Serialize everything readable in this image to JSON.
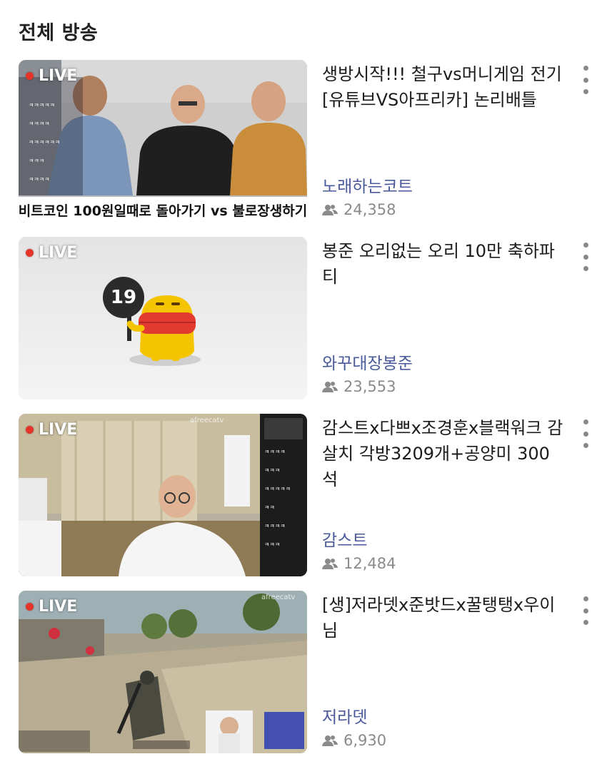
{
  "section": {
    "title": "전체 방송"
  },
  "live_label": "LIVE",
  "colors": {
    "live_dot": "#e5352a",
    "channel": "#4a5a9a",
    "viewers": "#8a8a8a"
  },
  "icons": {
    "viewers": "people-icon",
    "more": "more-vertical-icon"
  },
  "items": [
    {
      "title": "생방시작!!! 철구vs머니게임 전기 [유튜브VS아프리카] 논리배틀",
      "channel": "노래하는코트",
      "viewers": "24,358",
      "banner": "비트코인 100원일때로 돌아가기 vs 불로장생하기"
    },
    {
      "title": "봉준 오리없는 오리 10만 축하파티",
      "channel": "와꾸대장봉준",
      "viewers": "23,553",
      "badge": "19"
    },
    {
      "title": "감스트x다쁘x조경훈x블랙워크 감살치 각방3209개+공양미 300석",
      "channel": "감스트",
      "viewers": "12,484",
      "watermark": "afreecatv"
    },
    {
      "title": "[생]저라뎃x준밧드x꿀탱탱x우이님",
      "channel": "저라뎃",
      "viewers": "6,930",
      "watermark": "afreecatv"
    }
  ]
}
